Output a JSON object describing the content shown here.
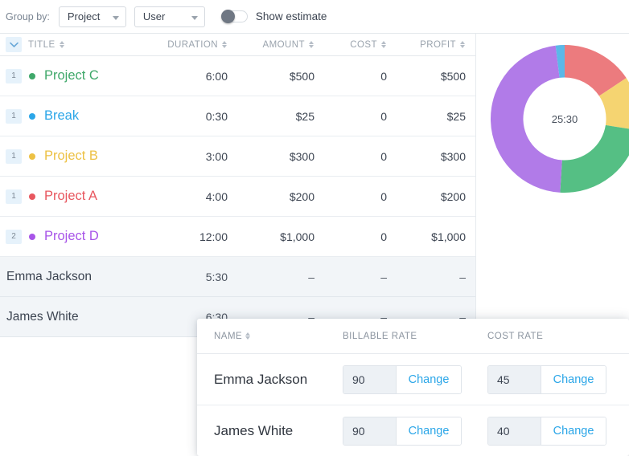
{
  "toolbar": {
    "group_by_label": "Group by:",
    "primary_select": "Project",
    "secondary_select": "User",
    "toggle_label": "Show estimate",
    "toggle_state": "off"
  },
  "table": {
    "columns": {
      "title": "TITLE",
      "duration": "DURATION",
      "amount": "AMOUNT",
      "cost": "COST",
      "profit": "PROFIT"
    },
    "rows": [
      {
        "count": "1",
        "title": "Project C",
        "color": "#3fa86a",
        "duration": "6:00",
        "amount": "$500",
        "cost": "0",
        "profit": "$500"
      },
      {
        "count": "1",
        "title": "Break",
        "color": "#2ba6e8",
        "duration": "0:30",
        "amount": "$25",
        "cost": "0",
        "profit": "$25"
      },
      {
        "count": "1",
        "title": "Project B",
        "color": "#edc144",
        "duration": "3:00",
        "amount": "$300",
        "cost": "0",
        "profit": "$300"
      },
      {
        "count": "1",
        "title": "Project A",
        "color": "#e8575f",
        "duration": "4:00",
        "amount": "$200",
        "cost": "0",
        "profit": "$200"
      },
      {
        "count": "2",
        "title": "Project D",
        "color": "#a855e8",
        "duration": "12:00",
        "amount": "$1,000",
        "cost": "0",
        "profit": "$1,000"
      }
    ],
    "summary_rows": [
      {
        "name": "Emma Jackson",
        "duration": "5:30",
        "amount": "–",
        "cost": "–",
        "profit": "–"
      },
      {
        "name": "James White",
        "duration": "6:30",
        "amount": "–",
        "cost": "–",
        "profit": "–"
      }
    ]
  },
  "chart_data": {
    "type": "pie",
    "title": "",
    "center_label": "25:30",
    "total_hours": 25.5,
    "categories": [
      "Project A",
      "Project B",
      "Project C",
      "Project D",
      "Break"
    ],
    "values": [
      4.0,
      3.0,
      6.0,
      12.0,
      0.5
    ],
    "value_labels": [
      "4:00",
      "3:00",
      "6:00",
      "12:00",
      "0:30"
    ],
    "colors": [
      "#ec7b7e",
      "#f5d471",
      "#55bf84",
      "#b17be8",
      "#5bb8e8"
    ],
    "legend": "none",
    "donut": true,
    "inner_radius_ratio": 0.56,
    "start_angle_deg": 0
  },
  "rates_panel": {
    "columns": {
      "name": "NAME",
      "billable_rate": "BILLABLE RATE",
      "cost_rate": "COST RATE"
    },
    "change_label": "Change",
    "rows": [
      {
        "name": "Emma Jackson",
        "billable_rate": "90",
        "cost_rate": "45"
      },
      {
        "name": "James White",
        "billable_rate": "90",
        "cost_rate": "40"
      }
    ]
  },
  "colors": {
    "accent_blue": "#2ba6e8",
    "badge_bg": "#e6f2fb",
    "summary_row_bg": "#f2f5f8",
    "border": "#e6eaee"
  }
}
